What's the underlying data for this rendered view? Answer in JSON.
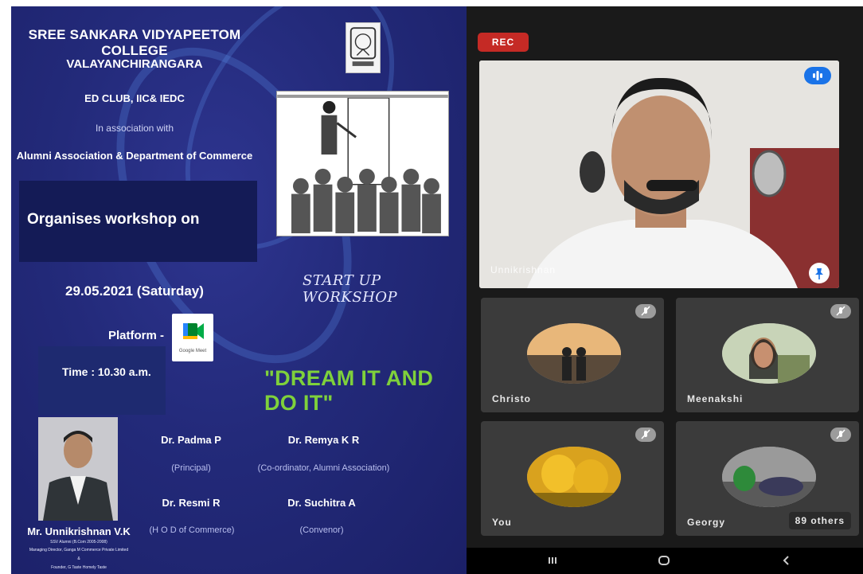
{
  "poster": {
    "college": "SREE SANKARA VIDYAPEETOM COLLEGE",
    "place": "VALAYANCHIRANGARA",
    "clubs": "ED CLUB, IIC& IEDC",
    "association_intro": "In association with",
    "association": "Alumni Association & Department of Commerce",
    "organises": "Organises workshop on",
    "date": "29.05.2021  (Saturday)",
    "workshop_title": "START UP WORKSHOP",
    "platform_label": "Platform -",
    "platform_logo_text": "Google Meet",
    "time": "Time : 10.30 a.m.",
    "slogan": "\"DREAM IT AND DO IT\"",
    "speaker": {
      "name": "Mr. Unnikrishnan V.K",
      "line1": "SSV Alumni (B.Com 2005-2008)",
      "line2": "Managing Director, Ganga M Commerce Private Limited",
      "line3": "&",
      "line4": "Founder, G Taste Homely Taste"
    },
    "people": [
      {
        "name": "Dr. Padma P",
        "role": "(Principal)"
      },
      {
        "name": "Dr. Remya K R",
        "role": "(Co-ordinator, Alumni Association)"
      },
      {
        "name": "Dr. Resmi R",
        "role": "(H O D of Commerce)"
      },
      {
        "name": "Dr. Suchitra A",
        "role": "(Convenor)"
      }
    ]
  },
  "meet": {
    "rec_label": "REC",
    "presenter": "Unnikrishnan",
    "participants": [
      {
        "name": "Christo"
      },
      {
        "name": "Meenakshi"
      },
      {
        "name": "You"
      },
      {
        "name": "Georgy"
      }
    ],
    "others_label": "89 others",
    "icons": {
      "speaking": "audio-wave-icon",
      "pin": "pin-icon",
      "muted": "mic-off-icon",
      "nav_recents": "recent-apps-icon",
      "nav_home": "home-icon",
      "nav_back": "back-icon"
    }
  },
  "colors": {
    "poster_bg": "#232a7a",
    "slogan": "#7fd13b",
    "rec": "#c52a25",
    "speak_indicator": "#1a73e8"
  }
}
